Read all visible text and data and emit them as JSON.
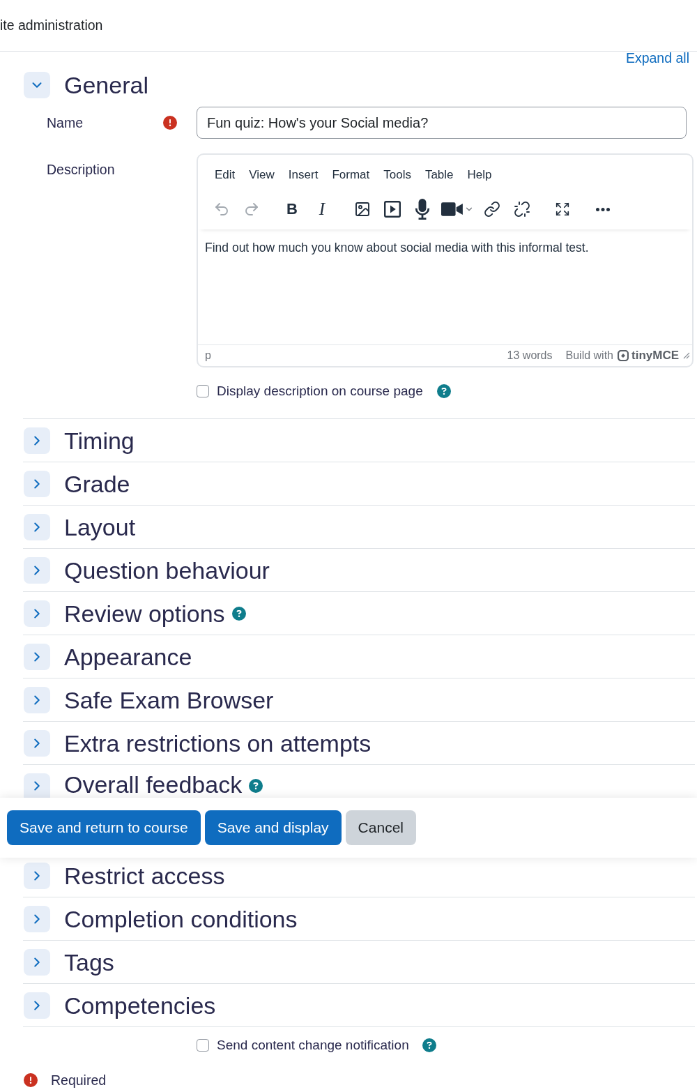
{
  "page_header": {
    "title": "ite administration"
  },
  "expand_all": {
    "label": "Expand all"
  },
  "general": {
    "title": "General",
    "expanded": true,
    "name": {
      "label": "Name",
      "required": true,
      "value": "Fun quiz: How's your Social media?"
    },
    "description": {
      "label": "Description",
      "editor": {
        "menu": [
          "Edit",
          "View",
          "Insert",
          "Format",
          "Tools",
          "Table",
          "Help"
        ],
        "toolbar_groups": [
          {
            "items": [
              {
                "kind": "undo",
                "disabled": true
              },
              {
                "kind": "redo",
                "disabled": true
              }
            ]
          },
          {
            "items": [
              {
                "kind": "bold",
                "label": "B",
                "disabled": false
              },
              {
                "kind": "italic",
                "label": "I",
                "disabled": false
              }
            ]
          },
          {
            "items": [
              {
                "kind": "image",
                "disabled": false
              },
              {
                "kind": "media",
                "disabled": false
              },
              {
                "kind": "microphone",
                "disabled": false
              },
              {
                "kind": "video",
                "disabled": false
              },
              {
                "kind": "link",
                "disabled": false
              },
              {
                "kind": "unlink",
                "disabled": false
              }
            ]
          },
          {
            "items": [
              {
                "kind": "fullscreen",
                "disabled": false
              }
            ]
          },
          {
            "items": [
              {
                "kind": "more",
                "disabled": false
              }
            ]
          }
        ],
        "content": "Find out how much you know about social media with this informal test.",
        "status": {
          "path": "p",
          "word_count": "13 words",
          "branding": "Build with",
          "brand": "tinyMCE"
        }
      }
    },
    "display_on_course_page": {
      "label": "Display description on course page",
      "checked": false,
      "help": true
    }
  },
  "sections": [
    {
      "title": "Timing",
      "expanded": false,
      "help": false
    },
    {
      "title": "Grade",
      "expanded": false,
      "help": false
    },
    {
      "title": "Layout",
      "expanded": false,
      "help": false
    },
    {
      "title": "Question behaviour",
      "expanded": false,
      "help": false
    },
    {
      "title": "Review options",
      "expanded": false,
      "help": true
    },
    {
      "title": "Appearance",
      "expanded": false,
      "help": false
    },
    {
      "title": "Safe Exam Browser",
      "expanded": false,
      "help": false
    },
    {
      "title": "Extra restrictions on attempts",
      "expanded": false,
      "help": false
    },
    {
      "title": "Overall feedback",
      "expanded": false,
      "help": true
    }
  ],
  "action_bar": {
    "buttons": [
      {
        "label": "Save and return to course",
        "kind": "primary"
      },
      {
        "label": "Save and display",
        "kind": "primary"
      },
      {
        "label": "Cancel",
        "kind": "secondary"
      }
    ]
  },
  "sections_after": [
    {
      "title": "Restrict access",
      "expanded": false,
      "help": false
    },
    {
      "title": "Completion conditions",
      "expanded": false,
      "help": false
    },
    {
      "title": "Tags",
      "expanded": false,
      "help": false
    },
    {
      "title": "Competencies",
      "expanded": false,
      "help": false
    }
  ],
  "notification": {
    "label": "Send content change notification",
    "checked": false,
    "help": true
  },
  "legend": {
    "label": "Required"
  }
}
